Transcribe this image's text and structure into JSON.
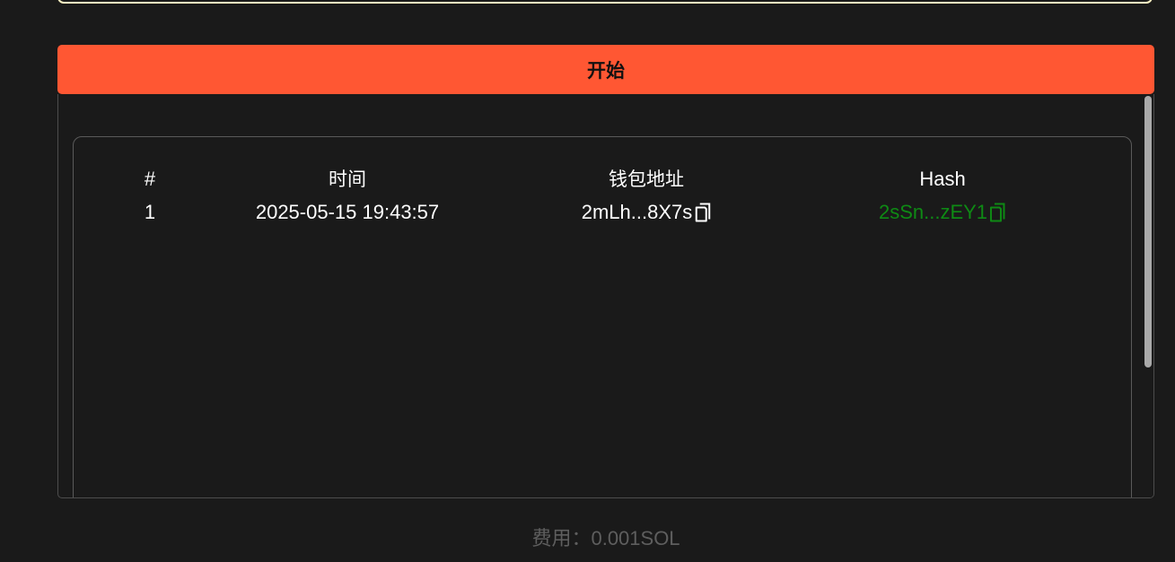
{
  "top_field": {},
  "start_button": {
    "label": "开始"
  },
  "table": {
    "headers": {
      "index": "#",
      "time": "时间",
      "wallet": "钱包地址",
      "hash": "Hash"
    },
    "rows": [
      {
        "index": "1",
        "time": "2025-05-15 19:43:57",
        "wallet": "2mLh...8X7s",
        "hash": "2sSn...zEY1"
      }
    ]
  },
  "footer": {
    "fee_label": "费用：",
    "fee_value": "0.001SOL"
  },
  "icons": {
    "copy": "copy-icon"
  },
  "colors": {
    "accent": "#ff5733",
    "hash_link": "#0e8a14",
    "background": "#1a1a1a",
    "input_border": "#fff5c2"
  }
}
